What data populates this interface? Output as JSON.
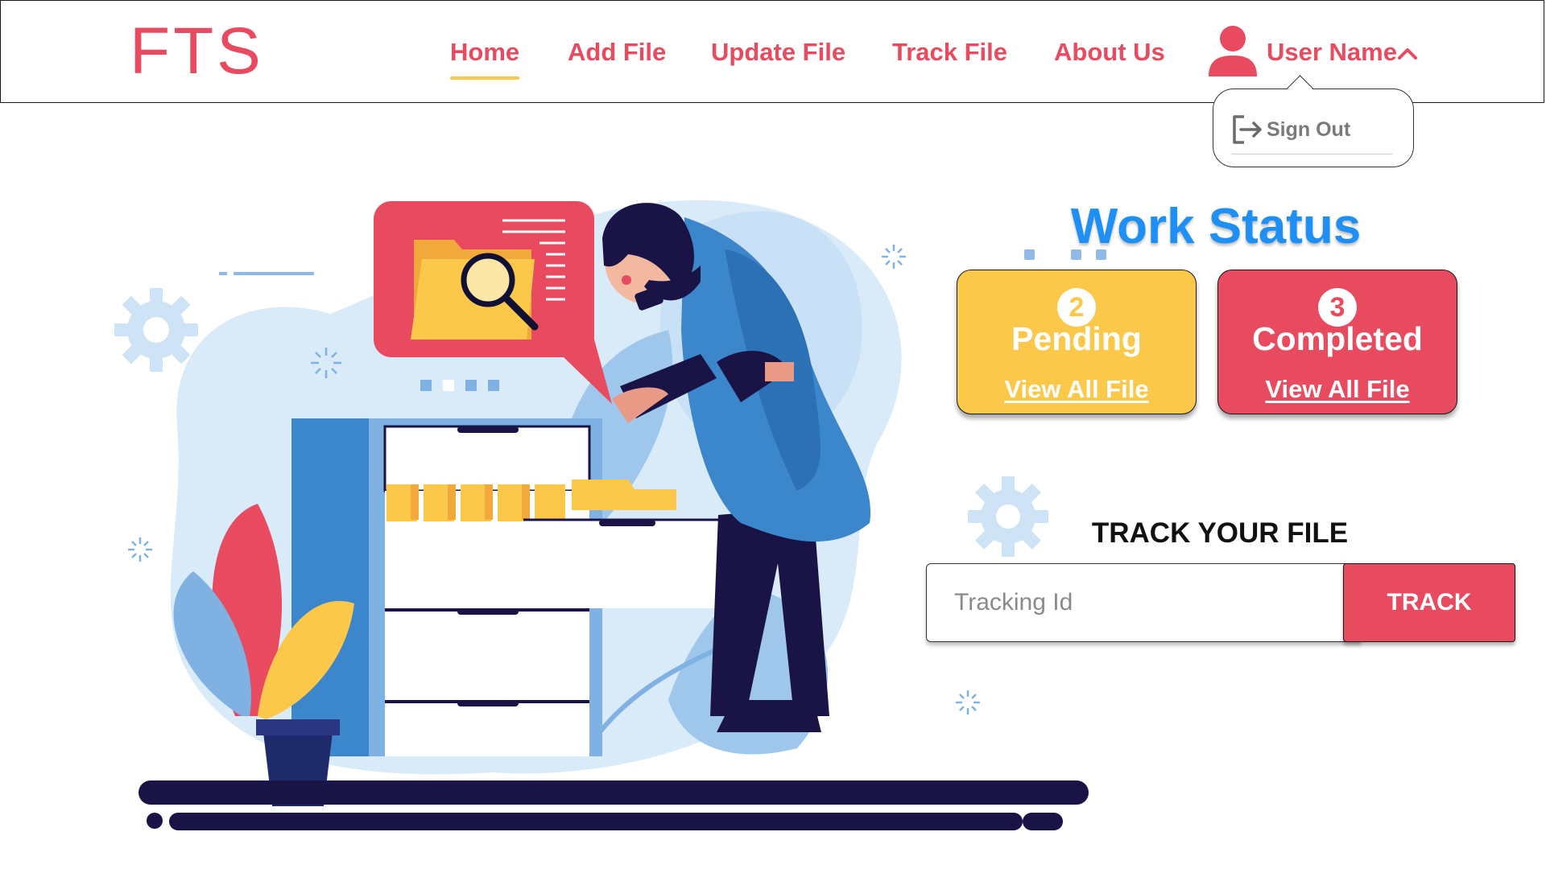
{
  "brand": {
    "logo_text": "FTS",
    "accent_color": "#e84a5f",
    "highlight_color": "#fcc84a",
    "title_color": "#1e90f5"
  },
  "nav": {
    "items": [
      {
        "label": "Home",
        "active": true
      },
      {
        "label": "Add File",
        "active": false
      },
      {
        "label": "Update File",
        "active": false
      },
      {
        "label": "Track File",
        "active": false
      },
      {
        "label": "About Us",
        "active": false
      }
    ],
    "user": {
      "label": "User Name",
      "icon": "user-icon",
      "menu_open": true
    },
    "user_menu": {
      "signout_label": "Sign Out",
      "signout_icon": "sign-out-icon"
    }
  },
  "work_status": {
    "title": "Work Status",
    "cards": [
      {
        "count": "2",
        "label": "Pending",
        "link_label": "View All File",
        "color": "#fcc84a"
      },
      {
        "count": "3",
        "label": "Completed",
        "link_label": "View All File",
        "color": "#e84a5f"
      }
    ]
  },
  "track": {
    "title": "TRACK YOUR FILE",
    "placeholder": "Tracking Id",
    "button_label": "TRACK"
  }
}
